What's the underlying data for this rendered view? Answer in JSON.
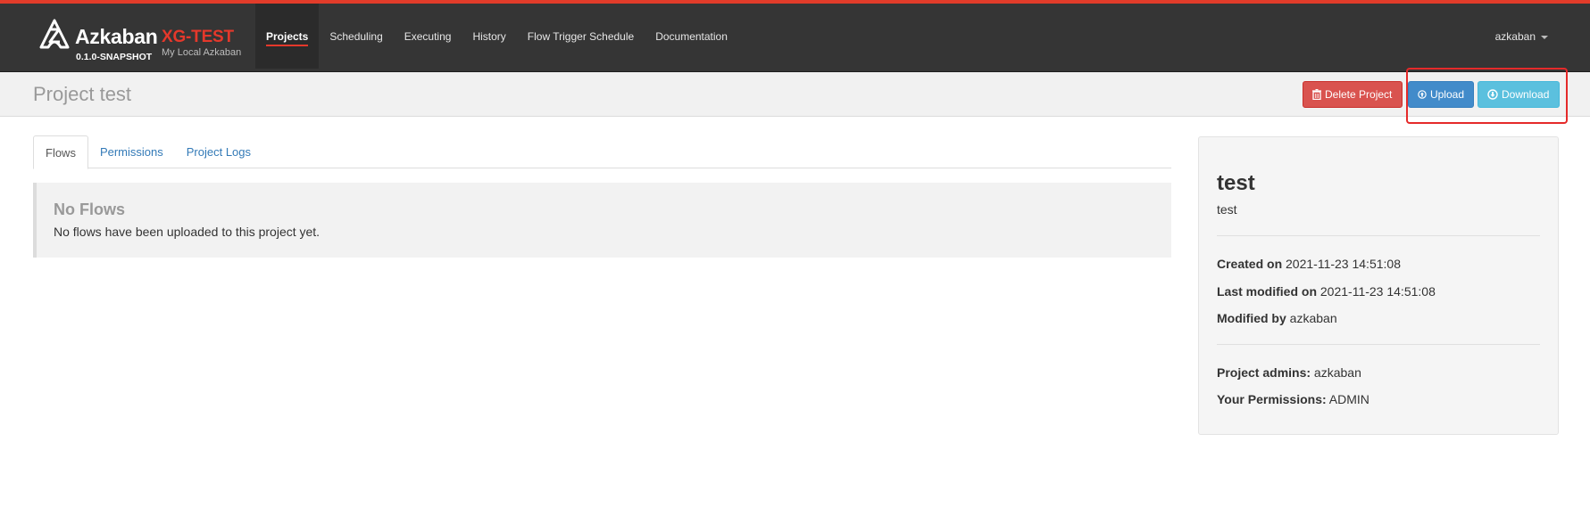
{
  "brand": {
    "name": "Azkaban",
    "env": "XG-TEST",
    "version": "0.1.0-SNAPSHOT",
    "subtitle": "My Local Azkaban"
  },
  "nav": [
    "Projects",
    "Scheduling",
    "Executing",
    "History",
    "Flow Trigger Schedule",
    "Documentation"
  ],
  "user": "azkaban",
  "header": {
    "title": "Project test",
    "delete_label": "Delete Project",
    "upload_label": "Upload",
    "download_label": "Download"
  },
  "tabs": [
    "Flows",
    "Permissions",
    "Project Logs"
  ],
  "empty": {
    "title": "No Flows",
    "message": "No flows have been uploaded to this project yet."
  },
  "panel": {
    "name": "test",
    "description": "test",
    "created_label": "Created on",
    "created_value": "2021-11-23 14:51:08",
    "modified_label": "Last modified on",
    "modified_value": "2021-11-23 14:51:08",
    "modified_by_label": "Modified by",
    "modified_by_value": "azkaban",
    "admins_label": "Project admins:",
    "admins_value": "azkaban",
    "permissions_label": "Your Permissions:",
    "permissions_value": "ADMIN"
  },
  "colors": {
    "accent": "#e5382b",
    "topbar": "#353535",
    "danger": "#d9534f",
    "primary": "#428bca",
    "info": "#5bc0de"
  }
}
